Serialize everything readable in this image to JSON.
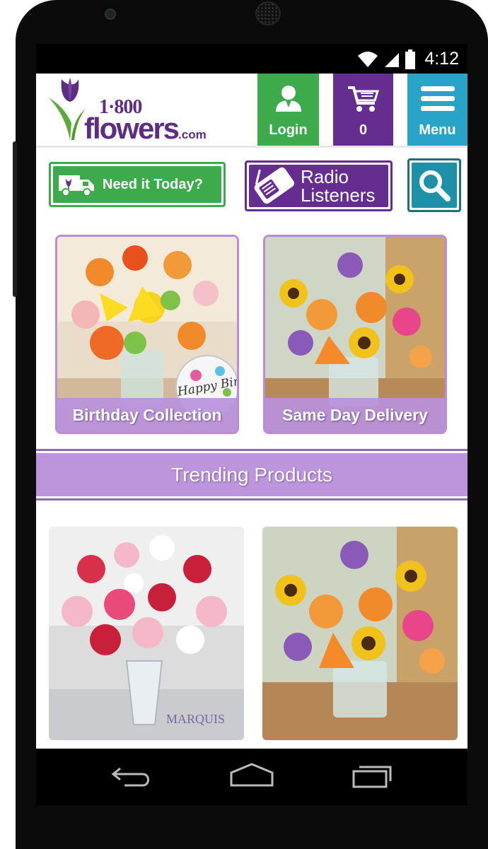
{
  "status_bar": {
    "time": "4:12"
  },
  "header": {
    "logo": {
      "number": "1·800",
      "word": "flowers",
      "suffix": ".com"
    },
    "login_label": "Login",
    "cart_count": "0",
    "menu_label": "Menu"
  },
  "toolbar": {
    "need_today_label": "Need it Today?",
    "radio_line1": "Radio",
    "radio_line2": "Listeners"
  },
  "tiles": [
    {
      "caption": "Birthday Collection",
      "balloon_text": "Happy Birthday"
    },
    {
      "caption": "Same Day Delivery"
    }
  ],
  "trending": {
    "title": "Trending Products"
  },
  "products": [
    {
      "brand": "MARQUIS"
    },
    {}
  ],
  "colors": {
    "green": "#3daa4c",
    "purple": "#652d90",
    "teal": "#2aa3c8",
    "lavender": "#bc95dd"
  },
  "icons": {
    "login": "user-icon",
    "cart": "shopping-cart-icon",
    "menu": "hamburger-icon",
    "search": "search-icon",
    "need_today": "delivery-truck-icon",
    "radio": "radio-icon"
  }
}
